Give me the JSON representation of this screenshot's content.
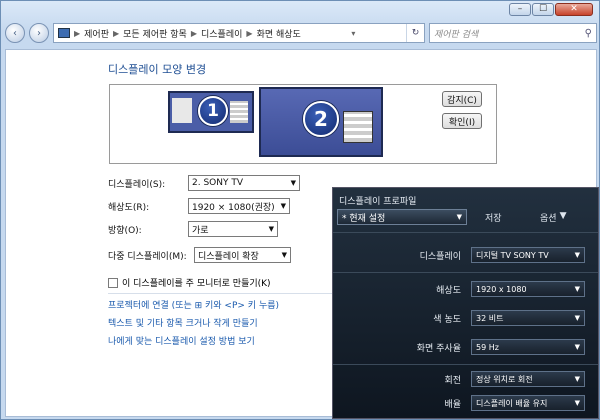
{
  "window": {
    "controls": {
      "minimize": "–",
      "maximize": "☐",
      "close": "✕"
    }
  },
  "nav": {
    "back_icon": "‹",
    "forward_icon": "›",
    "breadcrumb": [
      "제어판",
      "모든 제어판 항목",
      "디스플레이",
      "화면 해상도"
    ],
    "search_placeholder": "제어판 검색"
  },
  "main": {
    "title": "디스플레이 모양 변경",
    "monitors": {
      "one": "1",
      "two": "2"
    },
    "detect_button": "감지(C)",
    "identify_button": "확인(I)",
    "fields": [
      {
        "label": "디스플레이(S):",
        "value": "2. SONY TV"
      },
      {
        "label": "해상도(R):",
        "value": "1920 × 1080(권장)"
      },
      {
        "label": "방향(O):",
        "value": "가로"
      },
      {
        "label": "다중 디스플레이(M):",
        "value": "디스플레이 확장"
      }
    ],
    "main_display_checkbox": "이 디스플레이를 주 모니터로 만들기(K)",
    "links": [
      "프로젝터에 연결 (또는 ⊞ 키와 <P> 키 누름)",
      "텍스트 및 기타 항목 크거나 작게 만들기",
      "나에게 맞는 디스플레이 설정 방법 보기"
    ]
  },
  "overlay": {
    "title": "디스플레이 프로파일",
    "profile_value": "* 현재 설정",
    "save_label": "저장",
    "options_label": "옵션",
    "rows": [
      {
        "label": "디스플레이",
        "value": "디지털 TV SONY TV"
      },
      {
        "label": "해상도",
        "value": "1920 x 1080"
      },
      {
        "label": "색 농도",
        "value": "32 비트"
      },
      {
        "label": "화면 주사율",
        "value": "59 Hz"
      },
      {
        "label": "회전",
        "value": "정상 위치로 회전"
      },
      {
        "label": "배율",
        "value": "디스플레이 배율 유지"
      }
    ]
  }
}
